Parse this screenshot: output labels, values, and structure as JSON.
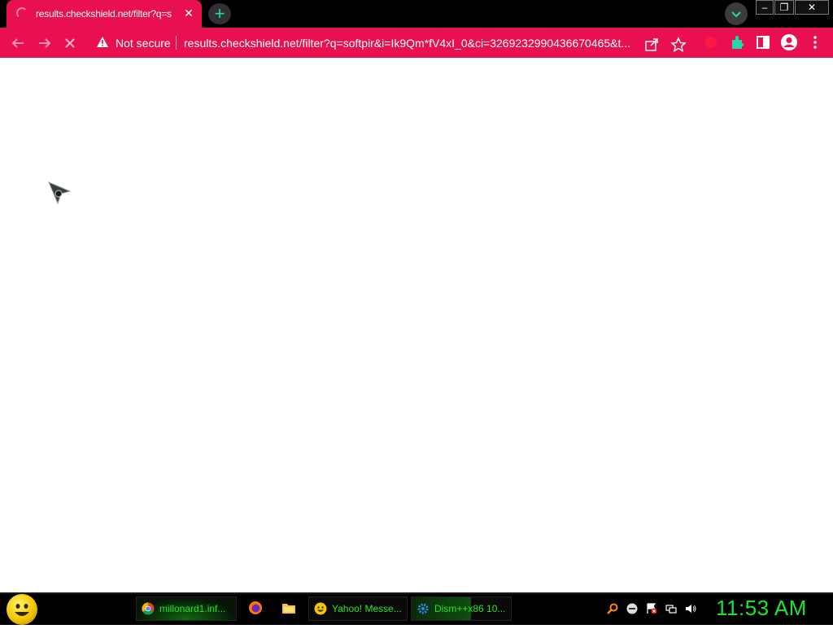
{
  "browser": {
    "tab": {
      "title": "results.checkshield.net/filter?q=s"
    },
    "new_tab_label": "+",
    "address_bar": {
      "security_label": "Not secure",
      "url": "results.checkshield.net/filter?q=softpir&i=Ik9Qm*fV4xI_0&ci=3269232990436670465&t..."
    },
    "window_controls": {
      "minimize": "–",
      "restore": "❐",
      "close": "✕"
    }
  },
  "taskbar": {
    "buttons": [
      {
        "label": "millonard1.inf...",
        "icon": "chrome-icon"
      },
      {
        "label": "Yahoo! Messe...",
        "icon": "yahoo-messenger-icon"
      },
      {
        "label": "Dism++x86 10...",
        "icon": "gear-icon"
      }
    ],
    "clock": "11:53 AM"
  },
  "colors": {
    "accent": "#e8104f",
    "taskbar_text": "#25e625",
    "clock": "#19e62a",
    "teal_icon": "#2ad4a8"
  }
}
